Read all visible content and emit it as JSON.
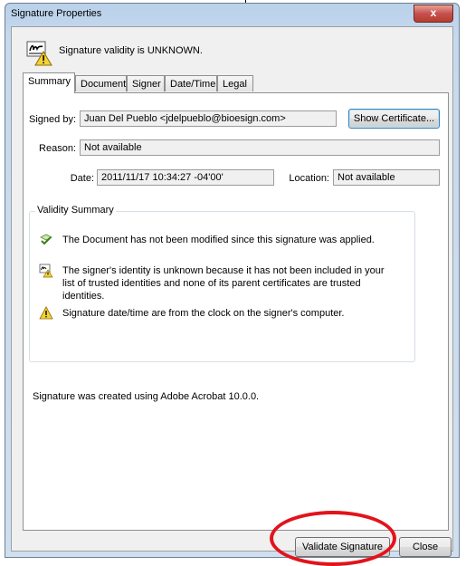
{
  "window": {
    "title": "Signature Properties",
    "close_label": "x"
  },
  "header": {
    "status_text": "Signature validity is UNKNOWN."
  },
  "tabs": [
    {
      "label": "Summary",
      "active": true
    },
    {
      "label": "Document",
      "active": false
    },
    {
      "label": "Signer",
      "active": false
    },
    {
      "label": "Date/Time",
      "active": false
    },
    {
      "label": "Legal",
      "active": false
    }
  ],
  "summary": {
    "signed_by_label": "Signed by:",
    "signed_by_value": "Juan  Del Pueblo <jdelpueblo@bioesign.com>",
    "show_certificate_label": "Show Certificate...",
    "reason_label": "Reason:",
    "reason_value": "Not available",
    "date_label": "Date:",
    "date_value": "2011/11/17 10:34:27 -04'00'",
    "location_label": "Location:",
    "location_value": "Not available"
  },
  "validity": {
    "title": "Validity Summary",
    "items": [
      {
        "icon": "check-icon",
        "text": "The Document has not been modified since this signature was applied."
      },
      {
        "icon": "unknown-identity-icon",
        "text": "The signer's identity is unknown because it has not been included in your list of trusted identities and none of its parent certificates are trusted identities."
      },
      {
        "icon": "warning-icon",
        "text": "Signature date/time are from the clock on the signer's computer."
      }
    ]
  },
  "footer_text": "Signature was created using Adobe Acrobat 10.0.0.",
  "buttons": {
    "validate_label": "Validate Signature",
    "close_label": "Close"
  },
  "colors": {
    "highlight": "#e3131b",
    "title_bar": "#b9d1ea"
  }
}
